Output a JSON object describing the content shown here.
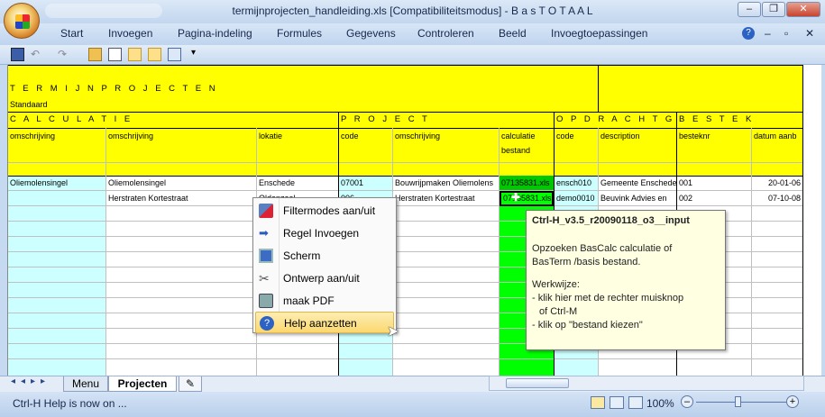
{
  "window": {
    "title": "termijnprojecten_handleiding.xls  [Compatibiliteitsmodus] - B a s T O T A A L",
    "controls": [
      "minimize",
      "restore",
      "close"
    ]
  },
  "menubar": {
    "items": [
      "Start",
      "Invoegen",
      "Pagina-indeling",
      "Formules",
      "Gegevens",
      "Controleren",
      "Beeld",
      "Invoegtoepassingen"
    ]
  },
  "sheet": {
    "title": "T E R M I J N P R O J E C T E N",
    "subtitle": "Standaard",
    "sections": {
      "calculatie": "C A L C U L A T I E",
      "project": "P R O J E C T",
      "opdrachtgever": "O P D R A C H T G E V E R",
      "bestek": "B E S T E K"
    },
    "columns": [
      "omschrijving",
      "omschrijving",
      "lokatie",
      "code",
      "omschrijving",
      "calculatie bestand",
      "code",
      "description",
      "besteknr",
      "datum aanb"
    ],
    "rows": [
      [
        "Oliemolensingel",
        "Oliemolensingel",
        "Enschede",
        "07001",
        "Bouwrijpmaken Oliemolens",
        "07135831.xls",
        "ensch010",
        "Gemeente Enschede",
        "001",
        "20-01-06"
      ],
      [
        "",
        "Herstraten Kortestraat",
        "Oldenzaal",
        "006",
        "Herstraten Kortestraat",
        "07135831.xls",
        "demo0010",
        "Beuvink Advies en",
        "002",
        "07-10-08"
      ]
    ]
  },
  "context_menu": {
    "items": [
      {
        "label": "Filtermodes aan/uit",
        "icon": "filter-icon"
      },
      {
        "label": "Regel Invoegen",
        "icon": "arrow-right-icon"
      },
      {
        "label": "Scherm",
        "icon": "screen-icon"
      },
      {
        "label": "Ontwerp aan/uit",
        "icon": "tools-icon"
      },
      {
        "label": "maak PDF",
        "icon": "pdf-icon"
      },
      {
        "label": "Help aanzetten",
        "icon": "help-icon"
      }
    ]
  },
  "tooltip": {
    "title": "Ctrl-H_v3.5_r20090118_o3__input",
    "line1": "Opzoeken BasCalc calculatie of",
    "line2": "BasTerm /basis bestand.",
    "line3": "Werkwijze:",
    "line4": "- klik hier met de rechter muisknop",
    "line5": "  of Ctrl-M",
    "line6": "- klik op \"bestand kiezen\""
  },
  "tabs": {
    "menu": "Menu",
    "projecten": "Projecten"
  },
  "status": {
    "text": "Ctrl-H Help is now on ...",
    "zoom": "100%"
  },
  "colors": {
    "yellow": "#ffff00",
    "green": "#00ff00",
    "cyan_light": "#ccffff"
  }
}
